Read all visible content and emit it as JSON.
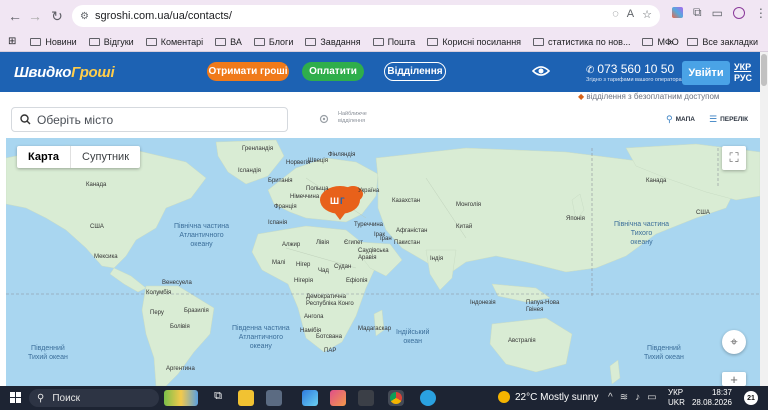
{
  "browser": {
    "url": "sgroshi.com.ua/ua/contacts/",
    "bookmarks": [
      "Новини",
      "Відгуки",
      "Коментарі",
      "ВА",
      "Блоги",
      "Завдання",
      "Пошта",
      "Корисні посилання",
      "статистика по нов...",
      "МФО"
    ],
    "all_bookmarks": "Все закладки"
  },
  "header": {
    "logo_part1": "Швидко",
    "logo_part2": "Гроші",
    "get_money": "Отримати гроші",
    "pay": "Оплатити",
    "branches": "Відділення",
    "phone": "073 560 10 50",
    "phone_note": "Згідно з тарифами вашого оператора",
    "login": "Увійти",
    "lang_ukr": "УКР",
    "lang_rus": "РУС"
  },
  "filters": {
    "city_placeholder": "Оберіть місто",
    "nearest_label": "Найближче відділення",
    "promo": "відділення з безоплатним доступом",
    "map_view": "МАПА",
    "list_view": "ПЕРЕЛІК"
  },
  "map": {
    "type_map": "Карта",
    "type_satellite": "Супутник",
    "oceans": {
      "n_atlantic": "Північна частина\nАтлантичного\nокеану",
      "s_atlantic": "Південна частина\nАтлантичного\nокеану",
      "indian": "Індійський\nокеан",
      "n_pacific_left": "",
      "s_pacific_left": "Південний\nТихий океан",
      "n_pacific_right": "Північна частина\nТихого\nокеану",
      "s_pacific_right": "Південний\nТихий океан"
    },
    "labels": {
      "greenland": "Гренландія",
      "iceland": "Ісландія",
      "britain": "Британія",
      "france": "Франція",
      "spain": "Іспанія",
      "algeria": "Алжир",
      "libya": "Лівія",
      "egypt": "Єгипет",
      "mali": "Малі",
      "niger": "Нігер",
      "chad": "Чад",
      "sudan": "Судан",
      "nigeria": "Нігерія",
      "ethiopia": "Ефіопія",
      "drc": "Демократична Республіка Конго",
      "angola": "Ангола",
      "namibia": "Намібія",
      "botswana": "Ботсвана",
      "south_africa": "ПАР",
      "madagascar": "Мадагаскар",
      "turkey": "Туреччина",
      "iraq": "Ірак",
      "iran": "Іран",
      "saudi": "Саудівська Аравія",
      "kazakhstan": "Казахстан",
      "mongolia": "Монголія",
      "china": "Китай",
      "india": "Індія",
      "pakistan": "Пакистан",
      "afghanistan": "Афганістан",
      "japan": "Японія",
      "indonesia": "Індонезія",
      "papua": "Папуа-Нова Гвінея",
      "australia": "Австралія",
      "canada": "Канада",
      "usa": "США",
      "mexico": "Мексика",
      "venezuela": "Венесуела",
      "colombia": "Колумбія",
      "peru": "Перу",
      "brazil": "Бразилія",
      "bolivia": "Болівія",
      "argentina": "Аргентина",
      "norway": "Норвегія",
      "finland": "Фінляндія",
      "poland": "Польща",
      "germany": "Німеччина",
      "sweden": "Швеція",
      "ukraine": "Україна"
    }
  },
  "taskbar": {
    "search": "Поиск",
    "weather": "22°C  Mostly sunny",
    "lang": "УКР",
    "lang2": "UKR",
    "time": "18:37",
    "date": "28.08.2026",
    "notifications": "21"
  }
}
